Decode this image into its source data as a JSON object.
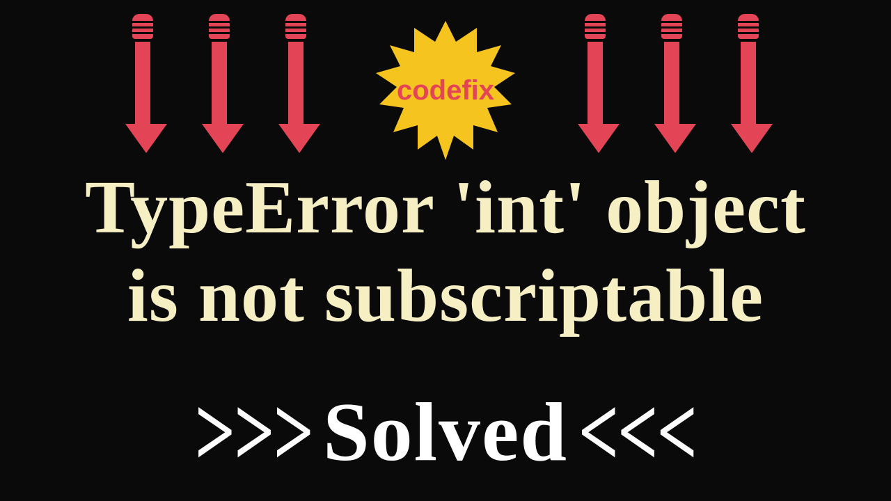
{
  "badge": {
    "label": "codefix",
    "fill_color": "#f6c41e",
    "text_color": "#e34556"
  },
  "arrows": {
    "color": "#e34556",
    "count_left": 3,
    "count_right": 3
  },
  "title": {
    "line1": "TypeError 'int' object",
    "line2": "is not subscriptable",
    "color": "#f6efc4"
  },
  "footer": {
    "left_chevrons": ">>>",
    "word": "Solved",
    "right_chevrons": "<<<",
    "color": "#ffffff"
  }
}
